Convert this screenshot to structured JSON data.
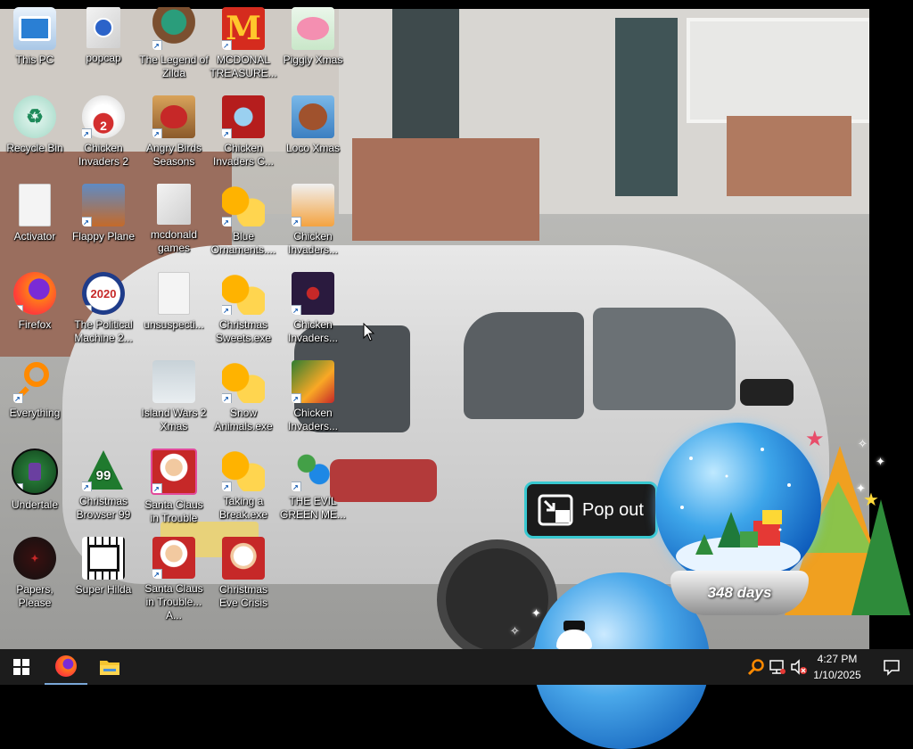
{
  "desktop": {
    "icons": [
      {
        "label": "This PC",
        "icon": "computer-icon"
      },
      {
        "label": "popcap",
        "icon": "folder-icon"
      },
      {
        "label": "The Legend of Zilda",
        "icon": "game-icon"
      },
      {
        "label": "MCDONAL TREASURE...",
        "icon": "mcdonalds-icon"
      },
      {
        "label": "Piggly Xmas",
        "icon": "pig-icon"
      },
      {
        "label": "Recycle Bin",
        "icon": "recycle-bin-icon"
      },
      {
        "label": "Chicken Invaders 2",
        "icon": "chicken-icon"
      },
      {
        "label": "Angry Birds Seasons",
        "icon": "angry-bird-icon"
      },
      {
        "label": "Chicken Invaders C...",
        "icon": "chicken-icon"
      },
      {
        "label": "Loco Xmas",
        "icon": "bear-icon"
      },
      {
        "label": "Activator",
        "icon": "file-icon"
      },
      {
        "label": "Flappy Plane",
        "icon": "plane-icon"
      },
      {
        "label": "mcdonald games",
        "icon": "folder-icon"
      },
      {
        "label": "Blue Ornaments....",
        "icon": "puzzle-icon"
      },
      {
        "label": "Chicken Invaders...",
        "icon": "chicken-icon"
      },
      {
        "label": "Firefox",
        "icon": "firefox-icon"
      },
      {
        "label": "The Political Machine 2...",
        "icon": "election-icon"
      },
      {
        "label": "unsuspecti...",
        "icon": "file-icon"
      },
      {
        "label": "Christmas Sweets.exe",
        "icon": "puzzle-icon"
      },
      {
        "label": "Chicken Invaders...",
        "icon": "chicken-icon"
      },
      {
        "label": "Everything",
        "icon": "search-icon"
      },
      {
        "label": "Island Wars 2 Xmas",
        "icon": "island-icon"
      },
      {
        "label": "Snow Animals.exe",
        "icon": "puzzle-icon"
      },
      {
        "label": "Chicken Invaders...",
        "icon": "chicken-icon"
      },
      {
        "label": "Undertale",
        "icon": "undertale-icon"
      },
      {
        "label": "Christmas Browser 99",
        "icon": "tree-icon"
      },
      {
        "label": "Santa Claus in Trouble",
        "icon": "santa-icon"
      },
      {
        "label": "Taking a Break.exe",
        "icon": "puzzle-icon"
      },
      {
        "label": "THE EVIL GREEN ME...",
        "icon": "messenger-icon"
      },
      {
        "label": "Papers, Please",
        "icon": "papers-please-icon"
      },
      {
        "label": "Super Hilda",
        "icon": "pixel-dog-icon"
      },
      {
        "label": "Santa Claus in Trouble... A...",
        "icon": "santa-icon"
      },
      {
        "label": "Christmas Eve Crisis",
        "icon": "santa-icon"
      }
    ]
  },
  "gadget": {
    "popout_label": "Pop out",
    "counter": "348 days"
  },
  "taskbar": {
    "time": "4:27 PM",
    "date": "1/10/2025"
  },
  "colors": {
    "taskbar": "#1c1c1c",
    "popout_border": "#38c8d0",
    "accent": "#7aa7d8"
  }
}
